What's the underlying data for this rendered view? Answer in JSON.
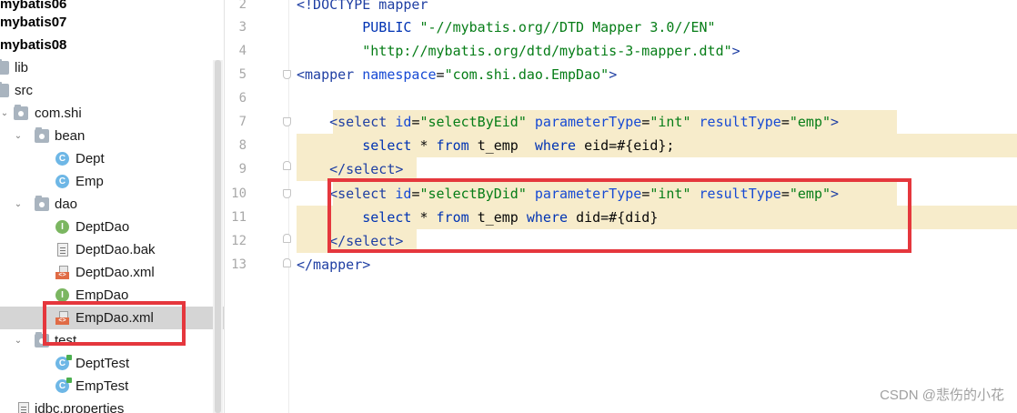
{
  "tree": {
    "modules": [
      "mybatis06",
      "mybatis07",
      "mybatis08"
    ],
    "items": {
      "lib": "lib",
      "src": "src",
      "com_shi": "com.shi",
      "bean": "bean",
      "dept": "Dept",
      "emp": "Emp",
      "dao": "dao",
      "dept_dao": "DeptDao",
      "dept_dao_bak": "DeptDao.bak",
      "dept_dao_xml": "DeptDao.xml",
      "emp_dao": "EmpDao",
      "emp_dao_xml": "EmpDao.xml",
      "test": "test",
      "dept_test": "DeptTest",
      "emp_test": "EmpTest",
      "jdbc_properties": "jdbc.properties"
    },
    "icon_letters": {
      "class": "C",
      "interface": "I",
      "xml_tag": "<>"
    }
  },
  "editor": {
    "line_numbers": [
      "2",
      "3",
      "4",
      "5",
      "6",
      "7",
      "8",
      "9",
      "10",
      "11",
      "12",
      "13"
    ],
    "lines": {
      "l2": {
        "tag": "<!DOCTYPE mapper"
      },
      "l3": {
        "indent": "        ",
        "kw": "PUBLIC ",
        "val": "\"-//mybatis.org//DTD Mapper 3.0//EN\""
      },
      "l4": {
        "indent": "        ",
        "val": "\"http://mybatis.org/dtd/mybatis-3-mapper.dtd\"",
        "tag_end": ">"
      },
      "l5": {
        "tag_open": "<mapper ",
        "attr": "namespace",
        "eq": "=",
        "val": "\"com.shi.dao.EmpDao\"",
        "tag_close": ">"
      },
      "l7": {
        "indent": "    ",
        "tag_open": "<select ",
        "attr1": "id",
        "val1": "\"selectByEid\"",
        "attr2": "parameterType",
        "val2": "\"int\"",
        "attr3": "resultType",
        "val3": "\"emp\"",
        "tag_close": ">"
      },
      "l8": {
        "indent": "        ",
        "kw1": "select ",
        "p1": "* ",
        "kw2": "from ",
        "p2": "t_emp  ",
        "kw3": "where ",
        "p3": "eid=#{eid};"
      },
      "l9": {
        "indent": "    ",
        "tag": "</select>"
      },
      "l10": {
        "indent": "    ",
        "tag_open": "<select ",
        "attr1": "id",
        "val1": "\"selectByDid\"",
        "attr2": "parameterType",
        "val2": "\"int\"",
        "attr3": "resultType",
        "val3": "\"emp\"",
        "tag_close": ">"
      },
      "l11": {
        "indent": "        ",
        "kw1": "select ",
        "p1": "* ",
        "kw2": "from ",
        "p2": "t_emp ",
        "kw3": "where ",
        "p3": "did=#{did}"
      },
      "l12": {
        "indent": "    ",
        "tag": "</select>"
      },
      "l13": {
        "tag": "</mapper>"
      }
    }
  },
  "watermark": "CSDN @悲伤的小花",
  "colors": {
    "highlight": "#f7eccb",
    "annotation_red": "#e5373d",
    "selection": "#d5d5d5"
  }
}
